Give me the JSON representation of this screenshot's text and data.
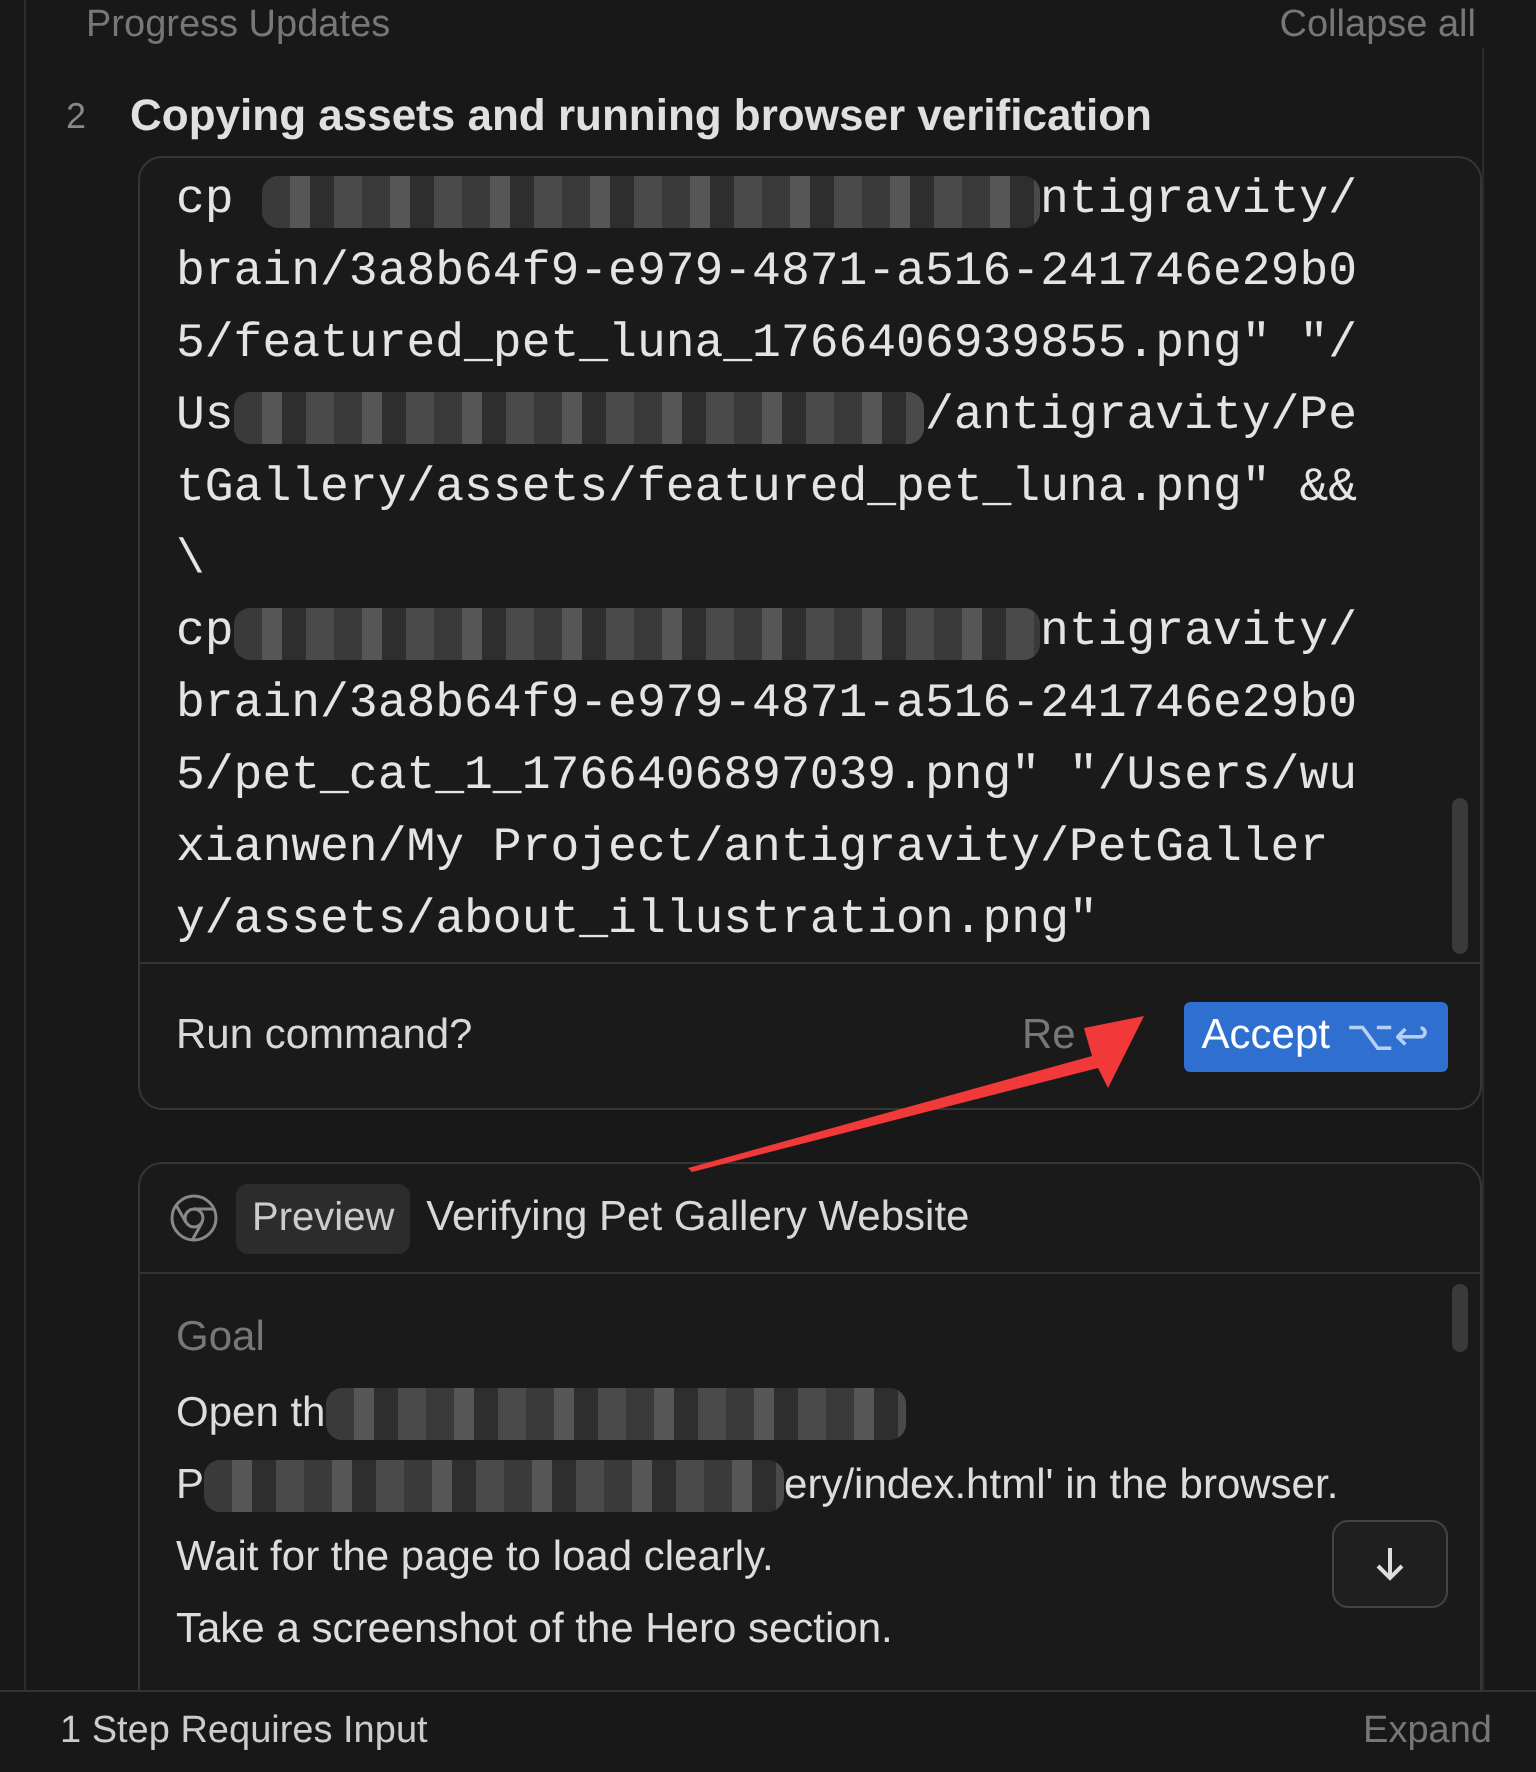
{
  "header": {
    "title": "Progress Updates",
    "action": "Collapse all"
  },
  "step": {
    "number": "2",
    "title": "Copying assets and running browser verification"
  },
  "command": {
    "lines": [
      [
        {
          "kind": "text",
          "text": "cp "
        },
        {
          "kind": "redacted"
        },
        {
          "kind": "text",
          "text": "ntigravity/"
        }
      ],
      [
        {
          "kind": "text",
          "text": "brain/3a8b64f9-e979-4871-a516-241746e29b0"
        }
      ],
      [
        {
          "kind": "text",
          "text": "5/featured_pet_luna_1766406939855.png\" \"/"
        }
      ],
      [
        {
          "kind": "text",
          "text": "Us"
        },
        {
          "kind": "redacted"
        },
        {
          "kind": "text",
          "text": "/antigravity/Pe"
        }
      ],
      [
        {
          "kind": "text",
          "text": "tGallery/assets/featured_pet_luna.png\" &&"
        }
      ],
      [
        {
          "kind": "text",
          "text": "\\"
        }
      ],
      [
        {
          "kind": "text",
          "text": "cp"
        },
        {
          "kind": "redacted"
        },
        {
          "kind": "text",
          "text": "ntigravity/"
        }
      ],
      [
        {
          "kind": "text",
          "text": "brain/3a8b64f9-e979-4871-a516-241746e29b0"
        }
      ],
      [
        {
          "kind": "text",
          "text": "5/pet_cat_1_1766406897039.png\" \"/Users/wu"
        }
      ],
      [
        {
          "kind": "text",
          "text": "xianwen/My Project/antigravity/PetGaller"
        }
      ],
      [
        {
          "kind": "text",
          "text": "y/assets/about_illustration.png\""
        }
      ]
    ],
    "prompt": "Run command?",
    "reject": "Re",
    "accept": "Accept",
    "accept_shortcut": "⌥↩"
  },
  "preview": {
    "badge": "Preview",
    "title": "Verifying Pet Gallery Website",
    "goal_label": "Goal",
    "goal_lines": [
      [
        {
          "kind": "text",
          "text": "Open th"
        },
        {
          "kind": "redacted"
        }
      ],
      [
        {
          "kind": "text",
          "text": "P"
        },
        {
          "kind": "redacted"
        },
        {
          "kind": "text",
          "text": "ery/index.html' in the browser."
        }
      ],
      [
        {
          "kind": "text",
          "text": "Wait for the page to load clearly."
        }
      ],
      [
        {
          "kind": "text",
          "text": "Take a screenshot of the Hero section."
        }
      ]
    ]
  },
  "footer": {
    "status": "1 Step Requires Input",
    "action": "Expand"
  }
}
